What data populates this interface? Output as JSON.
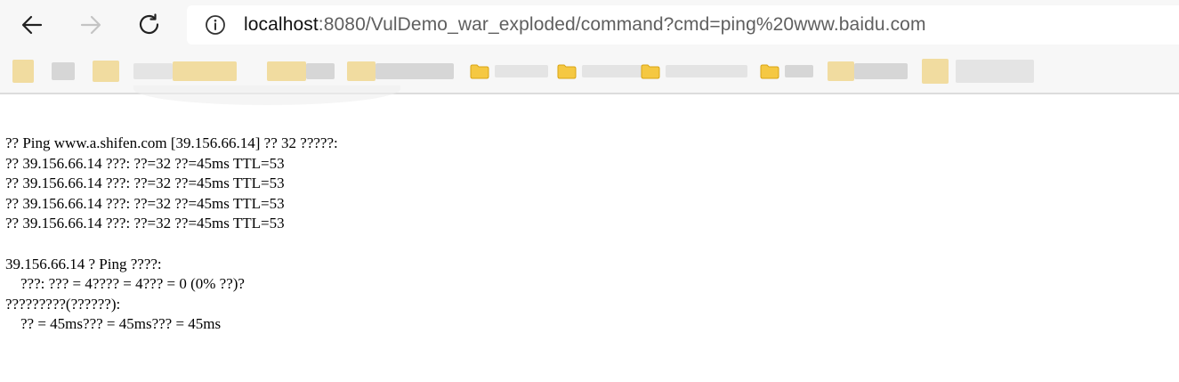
{
  "browser": {
    "nav": {
      "back_icon": "arrow-left-icon",
      "forward_icon": "arrow-right-icon",
      "reload_icon": "reload-icon"
    },
    "address_bar": {
      "info_icon": "info-circle-icon",
      "url_host": "localhost",
      "url_rest": ":8080/VulDemo_war_exploded/command?cmd=ping%20www.baidu.com"
    },
    "bookmarks": {
      "folder_icon": "folder-icon",
      "folder_color": "#f5c842",
      "visible_fragments": [
        "订阅",
        "翻译",
        "论坛",
        "在线工具"
      ]
    }
  },
  "output": {
    "lines": [
      "?? Ping www.a.shifen.com [39.156.66.14] ?? 32 ?????:",
      "?? 39.156.66.14 ???: ??=32 ??=45ms TTL=53",
      "?? 39.156.66.14 ???: ??=32 ??=45ms TTL=53",
      "?? 39.156.66.14 ???: ??=32 ??=45ms TTL=53",
      "?? 39.156.66.14 ???: ??=32 ??=45ms TTL=53",
      "",
      "39.156.66.14 ? Ping ????:",
      "    ???: ??? = 4???? = 4??? = 0 (0% ??)?",
      "?????????(??????):",
      "    ?? = 45ms??? = 45ms??? = 45ms"
    ]
  }
}
